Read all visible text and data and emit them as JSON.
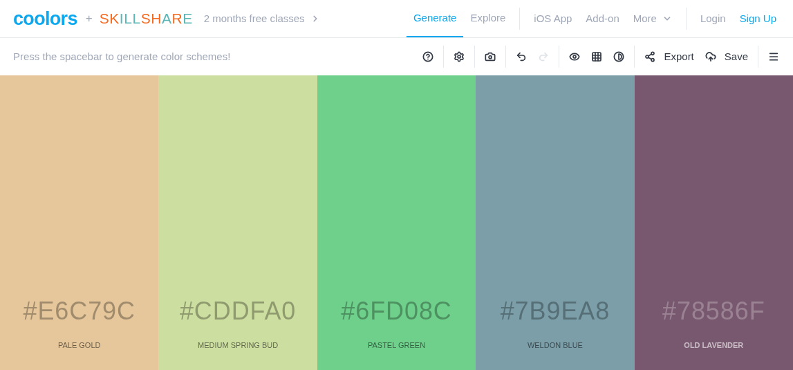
{
  "header": {
    "logo": "coolors",
    "plus": "+",
    "partner": "SKILLSHARE",
    "promo": "2 months free classes",
    "nav": [
      {
        "label": "Generate",
        "selected": true
      },
      {
        "label": "Explore",
        "selected": false
      }
    ],
    "links": [
      {
        "label": "iOS App",
        "kind": "link"
      },
      {
        "label": "Add-on",
        "kind": "link"
      },
      {
        "label": "More",
        "kind": "dropdown"
      }
    ],
    "auth": [
      {
        "label": "Login",
        "kind": "plain"
      },
      {
        "label": "Sign Up",
        "kind": "accent"
      }
    ]
  },
  "toolbar": {
    "hint": "Press the spacebar to generate color schemes!",
    "groups": [
      [
        {
          "disabled": false
        }
      ],
      [
        {
          "disabled": false
        }
      ],
      [
        {
          "disabled": false
        }
      ],
      [
        {
          "disabled": false
        },
        {
          "disabled": true
        }
      ],
      [
        {
          "disabled": false
        },
        {
          "disabled": false
        },
        {
          "disabled": false
        }
      ],
      [
        {
          "label": "Export",
          "disabled": false
        },
        {
          "label": "Save",
          "disabled": false
        }
      ],
      [
        {
          "disabled": false
        }
      ]
    ]
  },
  "palette": [
    {
      "hex": "#E6C79C",
      "name": "PALE GOLD",
      "color": "#e6c79c"
    },
    {
      "hex": "#CDDFA0",
      "name": "MEDIUM SPRING BUD",
      "color": "#cddfa0"
    },
    {
      "hex": "#6FD08C",
      "name": "PASTEL GREEN",
      "color": "#6fd08c"
    },
    {
      "hex": "#7B9EA8",
      "name": "WELDON BLUE",
      "color": "#7b9ea8"
    },
    {
      "hex": "#78586F",
      "name": "OLD LAVENDER",
      "color": "#78586f"
    }
  ]
}
